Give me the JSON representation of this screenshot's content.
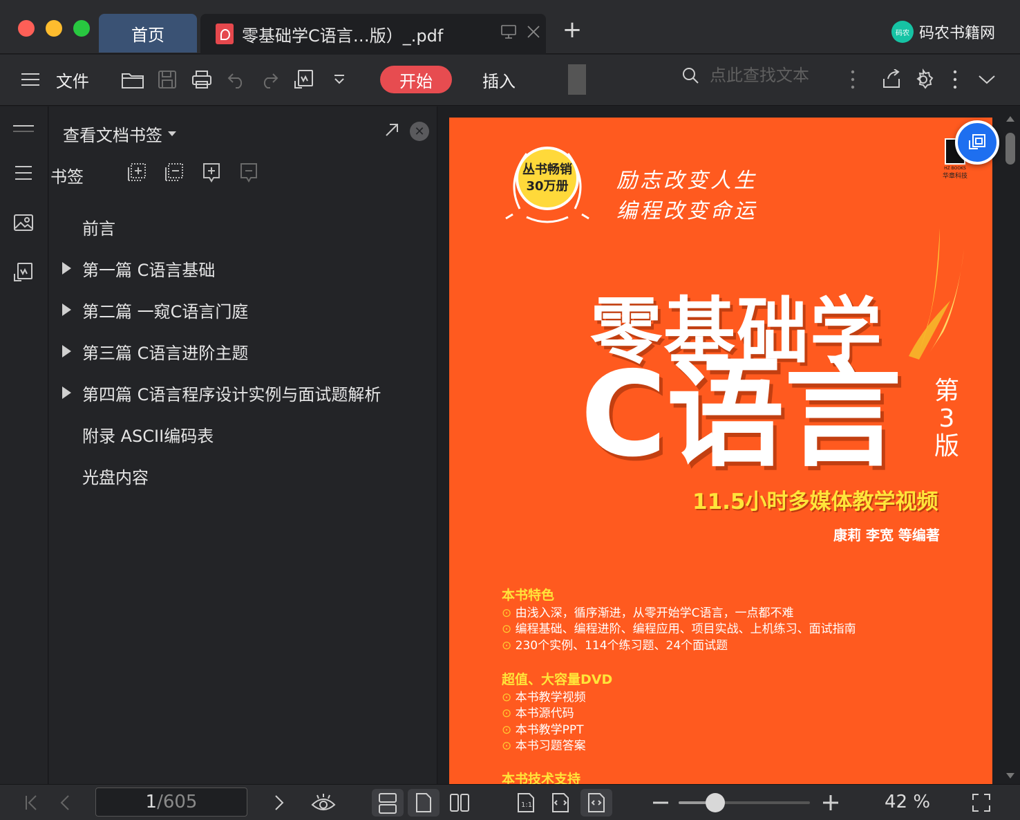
{
  "window": {
    "tabs": {
      "home": "首页",
      "doc": "零基础学C语言…版）_.pdf"
    },
    "brand": "码农书籍网",
    "brand_logo_text": "码农"
  },
  "toolbar": {
    "menu_label": "文件",
    "start_label": "开始",
    "insert_label": "插入",
    "search_placeholder": "点此查找文本"
  },
  "panel": {
    "header": "查看文档书签",
    "bookmarks_label": "书签",
    "items": [
      {
        "label": "前言",
        "expandable": false
      },
      {
        "label": "第一篇 C语言基础",
        "expandable": true
      },
      {
        "label": "第二篇 一窥C语言门庭",
        "expandable": true
      },
      {
        "label": "第三篇 C语言进阶主题",
        "expandable": true
      },
      {
        "label": "第四篇 C语言程序设计实例与面试题解析",
        "expandable": true
      },
      {
        "label": "附录 ASCII编码表",
        "expandable": false
      },
      {
        "label": "光盘内容",
        "expandable": false
      }
    ]
  },
  "cover": {
    "badge_line1": "丛书畅销",
    "badge_line2": "30万册",
    "slogan_line1": "励志改变人生",
    "slogan_line2": "编程改变命运",
    "publisher_text": "华章科技",
    "publisher_sub": "HZ BOOKS",
    "title_line1": "零基础学",
    "title_line2": "C语言",
    "edition": "第3版",
    "subtitle": "11.5小时多媒体教学视频",
    "authors": "康莉 李宽 等编著",
    "features_title": "本书特色",
    "features": [
      "由浅入深，循序渐进，从零开始学C语言，一点都不难",
      "编程基础、编程进阶、编程应用、项目实战、上机练习、面试指南",
      "230个实例、114个练习题、24个面试题"
    ],
    "dvd_title": "超值、大容量DVD",
    "dvd_items": [
      "本书教学视频",
      "本书源代码",
      "本书教学PPT",
      "本书习题答案"
    ],
    "support_title": "本书技术支持"
  },
  "status": {
    "current_page": "1",
    "total_pages": "/605",
    "zoom_fraction": 0.28,
    "zoom_label": "42 %"
  },
  "colors": {
    "accent": "#e74c50",
    "cover": "#ff5a1f",
    "home_tab": "#3a5274"
  }
}
